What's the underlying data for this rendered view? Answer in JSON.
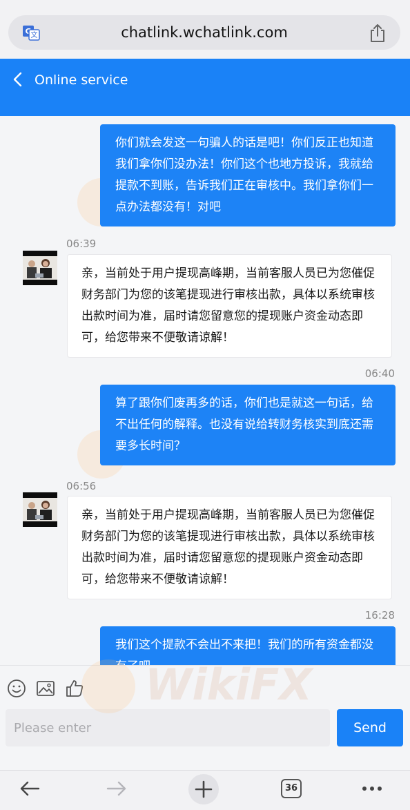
{
  "browser": {
    "url": "chatlink.wchatlink.com",
    "tab_count": "36"
  },
  "header": {
    "title": "Online service"
  },
  "messages": [
    {
      "side": "out",
      "time": "",
      "text": "你们就会发这一句骗人的话是吧！你们反正也知道我们拿你们没办法！你们这个也地方投诉，我就给提款不到账，告诉我们正在审核中。我们拿你们一点办法都没有！对吧"
    },
    {
      "side": "in",
      "time": "06:39",
      "text": "亲，当前处于用户提现高峰期，当前客服人员已为您催促财务部门为您的该笔提现进行审核出款，具体以系统审核出款时间为准，届时请您留意您的提现账户资金动态即可，给您带来不便敬请谅解！"
    },
    {
      "side": "out",
      "time": "06:40",
      "text": "算了跟你们废再多的话，你们也是就这一句话，给不出任何的解释。也没有说给转财务核实到底还需要多长时间？"
    },
    {
      "side": "in",
      "time": "06:56",
      "text": "亲，当前处于用户提现高峰期，当前客服人员已为您催促财务部门为您的该笔提现进行审核出款，具体以系统审核出款时间为准，届时请您留意您的提现账户资金动态即可，给您带来不便敬请谅解！"
    },
    {
      "side": "out",
      "time": "16:28",
      "text": "我们这个提款不会出不来把！我们的所有资金都没有了吧"
    }
  ],
  "composer": {
    "placeholder": "Please enter",
    "send_label": "Send"
  },
  "watermark": {
    "text": "WikiFX"
  },
  "colors": {
    "accent": "#1a82f7",
    "bubble_out": "#1d83f6",
    "bubble_in": "#ffffff",
    "background": "#f4f5f7"
  },
  "icons": [
    "translate-icon",
    "share-icon",
    "back-icon",
    "emoji-icon",
    "image-icon",
    "thumbs-up-icon",
    "back-arrow-icon",
    "forward-arrow-icon",
    "new-tab-plus-icon",
    "tabs-icon",
    "more-icon"
  ]
}
